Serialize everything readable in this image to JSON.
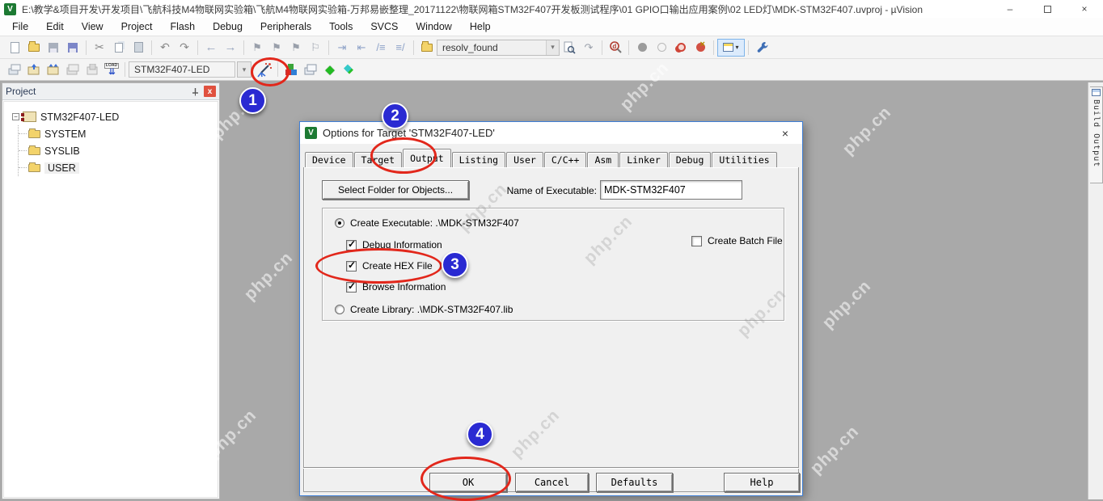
{
  "window": {
    "title": "E:\\教学&项目开发\\开发项目\\飞航科技M4物联网实验箱\\飞航M4物联网实验箱-万邦易嵌整理_20171122\\物联网箱STM32F407开发板测试程序\\01 GPIO口输出应用案例\\02 LED灯\\MDK-STM32F407.uvproj - µVision",
    "app_badge": "V",
    "minimize": "–",
    "close": "×"
  },
  "menu": {
    "items": [
      "File",
      "Edit",
      "View",
      "Project",
      "Flash",
      "Debug",
      "Peripherals",
      "Tools",
      "SVCS",
      "Window",
      "Help"
    ]
  },
  "toolbar1": {
    "search_value": "resolv_found"
  },
  "toolbar2": {
    "target_selected": "STM32F407-LED",
    "load_label": "LOAD"
  },
  "project_panel": {
    "title": "Project",
    "root": "STM32F407-LED",
    "folders": [
      "SYSTEM",
      "SYSLIB",
      "USER"
    ]
  },
  "build_output": {
    "label": "Build Output"
  },
  "dialog": {
    "title": "Options for Target 'STM32F407-LED'",
    "close": "×",
    "tabs": [
      "Device",
      "Target",
      "Output",
      "Listing",
      "User",
      "C/C++",
      "Asm",
      "Linker",
      "Debug",
      "Utilities"
    ],
    "active_tab": "Output",
    "select_folder_button": "Select Folder for Objects...",
    "name_of_executable_label": "Name of Executable:",
    "name_of_executable_value": "MDK-STM32F407",
    "output_group": {
      "create_executable": {
        "label": "Create Executable:  .\\MDK-STM32F407",
        "selected": true
      },
      "debug_information": {
        "label": "Debug Information",
        "checked": true
      },
      "create_hex": {
        "label": "Create HEX File",
        "checked": true
      },
      "browse_information": {
        "label": "Browse Information",
        "checked": true
      },
      "create_batch": {
        "label": "Create Batch File",
        "checked": false
      },
      "create_library": {
        "label": "Create Library: .\\MDK-STM32F407.lib",
        "selected": false
      }
    },
    "buttons": {
      "ok": "OK",
      "cancel": "Cancel",
      "defaults": "Defaults",
      "help": "Help"
    }
  },
  "annotations": {
    "steps": [
      "1",
      "2",
      "3",
      "4"
    ]
  },
  "watermark": {
    "text": "php.cn"
  },
  "colors": {
    "annotation_red": "#e2271b",
    "badge_blue": "#2a2ad2",
    "dialog_border": "#3f7fd6",
    "workspace_gray": "#a9a9a9"
  }
}
